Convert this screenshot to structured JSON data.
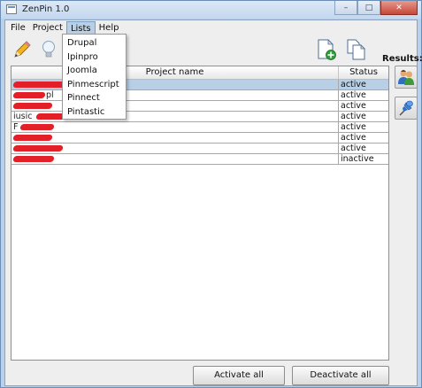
{
  "window": {
    "title": "ZenPin 1.0",
    "minimize": "–",
    "maximize": "□",
    "close": "✕"
  },
  "menubar": {
    "items": [
      "File",
      "Project",
      "Lists",
      "Help"
    ],
    "open_index": 2
  },
  "lists_menu": {
    "items": [
      "Drupal",
      "Ipinpro",
      "Joomla",
      "Pinmescript",
      "Pinnect",
      "Pintastic"
    ]
  },
  "toolbar": {
    "icons": [
      "pencil-icon",
      "lightbulb-icon",
      "new-document-icon",
      "copy-document-icon"
    ]
  },
  "table": {
    "headers": {
      "name": "Project name",
      "status": "Status"
    },
    "rows": [
      {
        "name_visible": "",
        "status": "active",
        "selected": true
      },
      {
        "name_visible": "pl",
        "status": "active",
        "selected": false
      },
      {
        "name_visible": "",
        "status": "active",
        "selected": false
      },
      {
        "name_visible": "iusic",
        "status": "active",
        "selected": false
      },
      {
        "name_visible": "F",
        "status": "active",
        "selected": false
      },
      {
        "name_visible": "",
        "status": "active",
        "selected": false
      },
      {
        "name_visible": "",
        "status": "active",
        "selected": false
      },
      {
        "name_visible": "",
        "status": "inactive",
        "selected": false
      }
    ]
  },
  "results": {
    "label": "Results:",
    "icons": [
      "users-icon",
      "pushpin-icon"
    ]
  },
  "buttons": {
    "activate_all": "Activate all",
    "deactivate_all": "Deactivate all"
  },
  "colors": {
    "selection": "#b8cfe5",
    "redaction": "#e32028"
  }
}
